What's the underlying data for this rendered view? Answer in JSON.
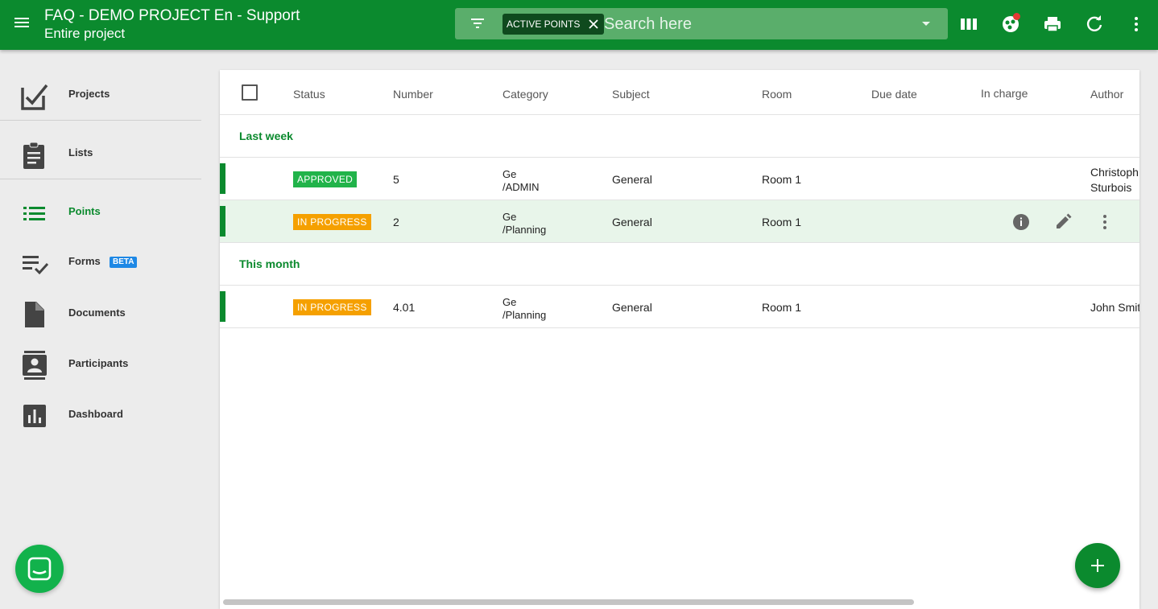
{
  "header": {
    "title": "FAQ - DEMO PROJECT En - Support",
    "subtitle": "Entire project",
    "filter_chip": "ACTIVE POINTS",
    "search_placeholder": "Search here",
    "brand_color": "#0b8a2e"
  },
  "sidebar": {
    "items": [
      {
        "label": "Projects",
        "icon": "checkbox-pencil-icon"
      },
      {
        "label": "Lists",
        "icon": "clipboard-icon"
      },
      {
        "label": "Points",
        "icon": "list-icon",
        "active": true
      },
      {
        "label": "Forms",
        "icon": "playlist-check-icon",
        "badge": "BETA"
      },
      {
        "label": "Documents",
        "icon": "document-icon"
      },
      {
        "label": "Participants",
        "icon": "contacts-icon"
      },
      {
        "label": "Dashboard",
        "icon": "bar-chart-icon"
      }
    ]
  },
  "table": {
    "columns": [
      "Status",
      "Number",
      "Category",
      "Subject",
      "Room",
      "Due date",
      "In charge",
      "Author"
    ],
    "groups": [
      {
        "label": "Last week",
        "rows": [
          {
            "status": "APPROVED",
            "status_color": "#21b34a",
            "number": "5",
            "category_line1": "Ge",
            "category_line2": "/ADMIN",
            "subject": "General",
            "room": "Room 1",
            "author_line1": "Christoph",
            "author_line2": "Sturbois"
          },
          {
            "status": "IN PROGRESS",
            "status_color": "#f5a000",
            "number": "2",
            "category_line1": "Ge",
            "category_line2": "/Planning",
            "subject": "General",
            "room": "Room 1",
            "author_line1": "",
            "author_line2": ""
          }
        ]
      },
      {
        "label": "This month",
        "rows": [
          {
            "status": "IN PROGRESS",
            "status_color": "#f5a000",
            "number": "4.01",
            "category_line1": "Ge",
            "category_line2": "/Planning",
            "subject": "General",
            "room": "Room 1",
            "author_line1": "John Smit",
            "author_line2": ""
          }
        ]
      }
    ]
  }
}
